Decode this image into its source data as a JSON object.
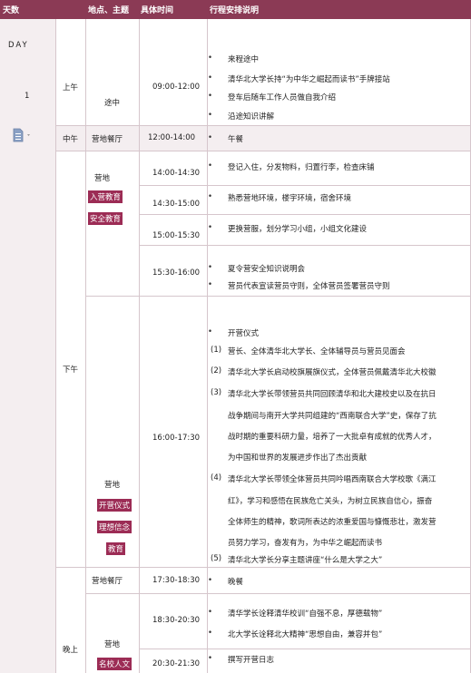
{
  "header": {
    "col_day": "天数",
    "col_place": "地点、主题",
    "col_time": "具体时间",
    "col_desc": "行程安排说明"
  },
  "day": {
    "label": "DAY",
    "number": "1"
  },
  "periods": {
    "morning": "上午",
    "noon": "中午",
    "afternoon": "下午",
    "evening": "晚上"
  },
  "places": {
    "onroad": "途中",
    "restaurant1": "营地餐厅",
    "camp1": "营地",
    "tag_entry": "入营教育",
    "tag_safety": "安全教育",
    "camp2": "营地",
    "tag_open": "开营仪式",
    "tag_ideal": "理想信念",
    "tag_edu": "教育",
    "restaurant2": "营地餐厅",
    "camp3": "营地",
    "tag_famous": "名校人文"
  },
  "times": {
    "t1": "09:00-12:00",
    "t2": "12:00-14:00",
    "t3": "14:00-14:30",
    "t4": "14:30-15:00",
    "t5": "15:00-15:30",
    "t6": "15:30-16:00",
    "t7": "16:00-17:30",
    "t8": "17:30-18:30",
    "t9": "18:30-20:30",
    "t10": "20:30-21:30"
  },
  "desc": {
    "m1": "来程途中",
    "m2": "清华北大学长持“为中华之崛起而读书”手牌接站",
    "m3": "登车后随车工作人员做自我介绍",
    "m4": "沿途知识讲解",
    "n1": "午餐",
    "a1": "登记入住，分发物料，归置行李，检查床铺",
    "a2": "熟悉营地环境，楼宇环境，宿舍环境",
    "a3": "更换营服，划分学习小组，小组文化建设",
    "a4": "夏令营安全知识说明会",
    "a5": "营员代表宣读营员守则，全体营员签署营员守则",
    "o1": "开营仪式",
    "o2n": "(1)",
    "o2": "营长、全体清华北大学长、全体辅导员与营员见面会",
    "o3n": "(2)",
    "o3": "清华北大学长启动校旗展旗仪式，全体营员佩戴清华北大校徽",
    "o4n": "(3)",
    "o4a": "清华北大学长带领营员共同回顾清华和北大建校史以及在抗日",
    "o4b": "战争期间与南开大学共同组建的“西南联合大学”史，保存了抗",
    "o4c": "战时期的重要科研力量，培养了一大批卓有成就的优秀人才，",
    "o4d": "为中国和世界的发展进步作出了杰出贡献",
    "o5n": "(4)",
    "o5a": "清华北大学长带领全体营员共同吟唱西南联合大学校歌《满江",
    "o5b": "红》，学习和感悟在民族危亡关头，为树立民族自信心，振奋",
    "o5c": "全体师生的精神，歌词所表达的浓重爱国与慷慨悲壮，激发营",
    "o5d": "员努力学习，奋发有为，为中华之崛起而读书",
    "o6n": "(5)",
    "o6": "清华北大学长分享主题讲座“什么是大学之大”",
    "e1": "晚餐",
    "e2": "清华学长诠释清华校训“自强不息，厚德载物”",
    "e3": "北大学长诠释北大精神“思想自由，兼容并包”",
    "e4": "撰写开营日志"
  }
}
